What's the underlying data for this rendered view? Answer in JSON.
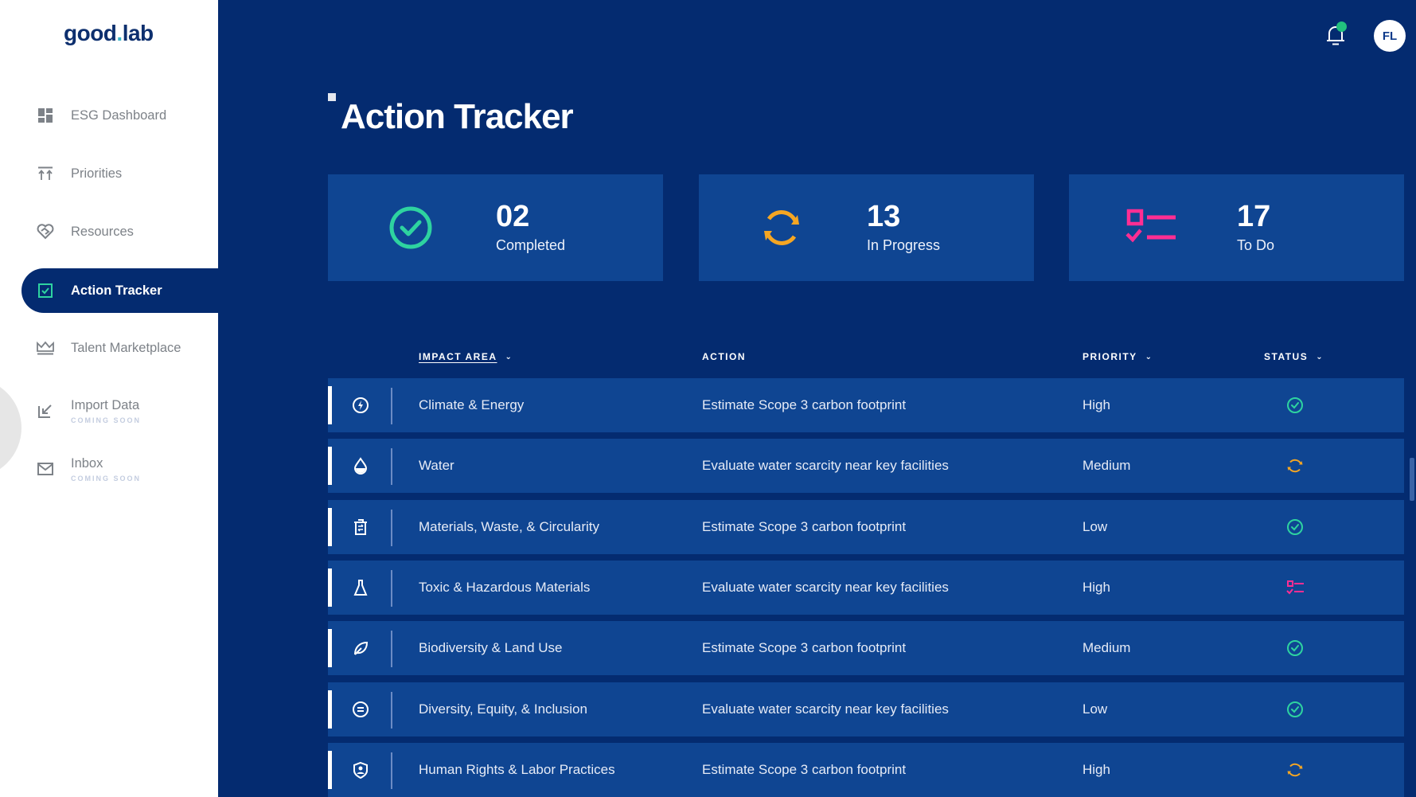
{
  "app": {
    "logo_main": "good",
    "logo_dot": ".",
    "logo_tail": "lab"
  },
  "sidebar": {
    "items": [
      {
        "label": "ESG Dashboard",
        "icon": "dashboard-icon",
        "sub": ""
      },
      {
        "label": "Priorities",
        "icon": "priorities-icon",
        "sub": ""
      },
      {
        "label": "Resources",
        "icon": "heart-handshake-icon",
        "sub": ""
      },
      {
        "label": "Action Tracker",
        "icon": "checkbox-icon",
        "sub": "",
        "active": true
      },
      {
        "label": "Talent Marketplace",
        "icon": "crown-icon",
        "sub": ""
      },
      {
        "label": "Import Data",
        "icon": "import-icon",
        "sub": "COMING SOON"
      },
      {
        "label": "Inbox",
        "icon": "mail-icon",
        "sub": "COMING SOON"
      }
    ]
  },
  "header": {
    "user_initials": "FL",
    "notification_badge": true
  },
  "page": {
    "title": "Action Tracker"
  },
  "stats": [
    {
      "value": "02",
      "label": "Completed",
      "icon": "check-circle-icon",
      "color": "#2ed3a0"
    },
    {
      "value": "13",
      "label": "In Progress",
      "icon": "refresh-icon",
      "color": "#f5a623"
    },
    {
      "value": "17",
      "label": "To Do",
      "icon": "todo-list-icon",
      "color": "#ff2e93"
    }
  ],
  "table": {
    "columns": [
      {
        "label": "IMPACT AREA",
        "sortable": true,
        "active": true
      },
      {
        "label": "ACTION",
        "sortable": false
      },
      {
        "label": "PRIORITY",
        "sortable": true
      },
      {
        "label": "STATUS",
        "sortable": true
      }
    ],
    "rows": [
      {
        "icon": "lightning-icon",
        "area": "Climate & Energy",
        "action": "Estimate Scope 3 carbon footprint",
        "priority": "High",
        "status": "completed"
      },
      {
        "icon": "water-drop-icon",
        "area": "Water",
        "action": "Evaluate water scarcity near key facilities",
        "priority": "Medium",
        "status": "in-progress"
      },
      {
        "icon": "recycle-bin-icon",
        "area": "Materials, Waste, & Circularity",
        "action": "Estimate Scope 3 carbon footprint",
        "priority": "Low",
        "status": "completed"
      },
      {
        "icon": "flask-icon",
        "area": "Toxic & Hazardous Materials",
        "action": "Evaluate water scarcity near key facilities",
        "priority": "High",
        "status": "to-do"
      },
      {
        "icon": "leaf-icon",
        "area": "Biodiversity & Land Use",
        "action": "Estimate Scope 3 carbon footprint",
        "priority": "Medium",
        "status": "completed"
      },
      {
        "icon": "equals-circle-icon",
        "area": "Diversity, Equity, & Inclusion",
        "action": "Evaluate water scarcity near key facilities",
        "priority": "Low",
        "status": "completed"
      },
      {
        "icon": "shield-person-icon",
        "area": "Human Rights & Labor Practices",
        "action": "Estimate Scope 3 carbon footprint",
        "priority": "High",
        "status": "in-progress"
      }
    ]
  },
  "colors": {
    "background": "#042b70",
    "card": "#0f4592",
    "completed": "#2ed3a0",
    "in_progress": "#f5a623",
    "to_do": "#ff2e93"
  }
}
